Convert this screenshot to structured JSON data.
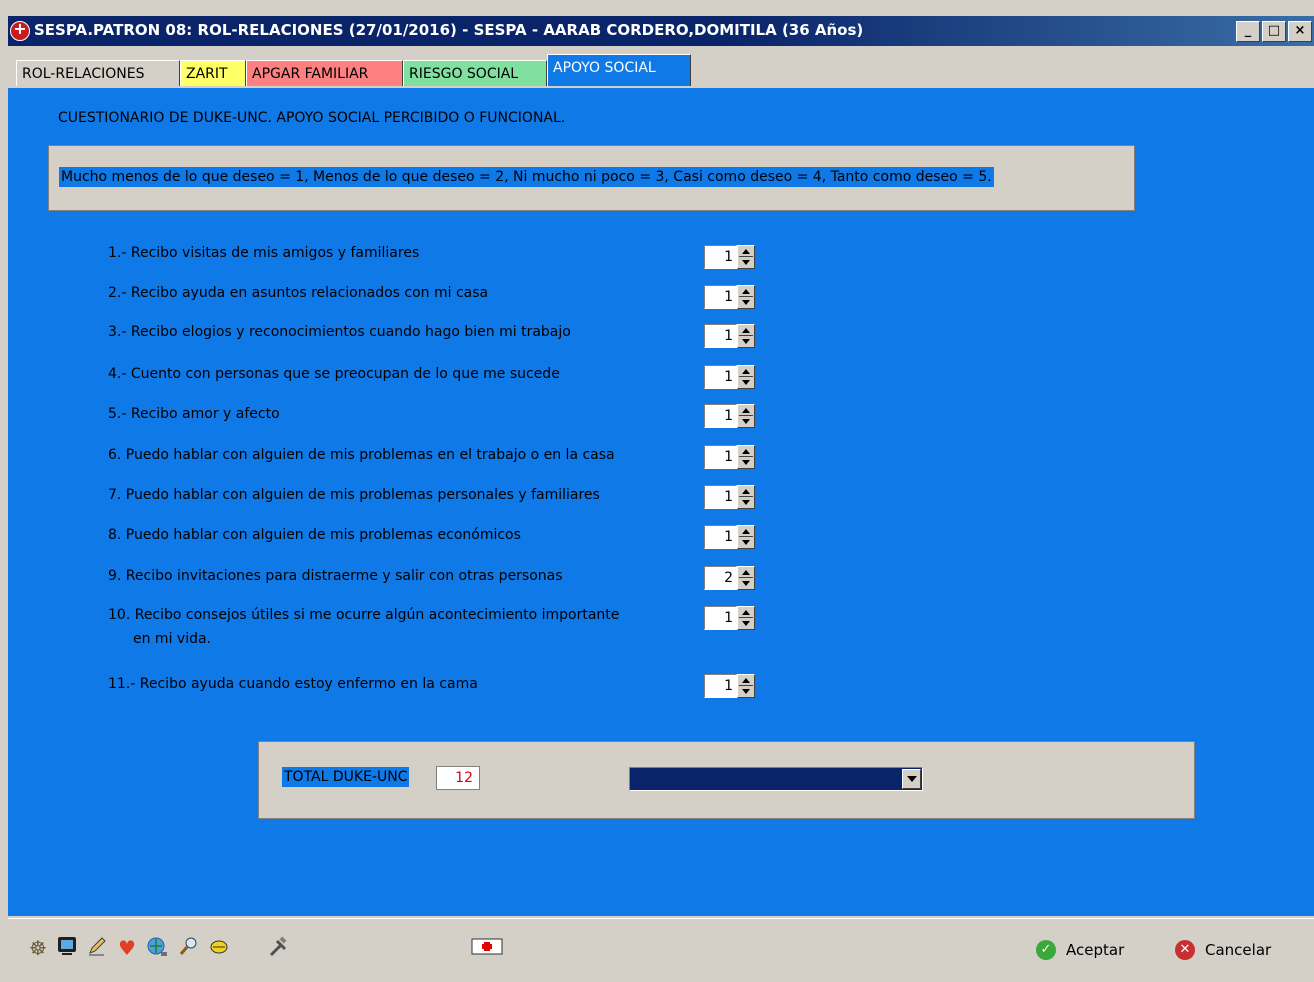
{
  "window": {
    "title": "SESPA.PATRON 08: ROL-RELACIONES (27/01/2016) - SESPA - AARAB CORDERO,DOMITILA (36 Años)",
    "minimize_label": "_",
    "maximize_label": "□",
    "close_label": "×"
  },
  "tabs": [
    {
      "label": "ROL-RELACIONES",
      "color": "#d4d0c8"
    },
    {
      "label": "ZARIT",
      "color": "#ffff66"
    },
    {
      "label": "APGAR FAMILIAR",
      "color": "#ff8080"
    },
    {
      "label": "RIESGO SOCIAL",
      "color": "#80e0a0"
    },
    {
      "label": "APOYO SOCIAL",
      "color": "#0f79e8"
    }
  ],
  "form": {
    "heading": "CUESTIONARIO DE DUKE-UNC. APOYO SOCIAL PERCIBIDO O FUNCIONAL.",
    "scale_text": "Mucho menos de lo que deseo = 1, Menos de lo que deseo = 2, Ni mucho ni poco = 3, Casi como deseo = 4, Tanto como deseo = 5.",
    "questions": [
      {
        "label": "1.- Recibo visitas de mis amigos y familiares",
        "value": "1"
      },
      {
        "label": "2.- Recibo ayuda en asuntos relacionados con mi casa",
        "value": "1"
      },
      {
        "label": "3.- Recibo elogios y reconocimientos cuando hago bien mi trabajo",
        "value": "1"
      },
      {
        "label": "4.- Cuento con personas que se preocupan de lo que me sucede",
        "value": "1"
      },
      {
        "label": "5.- Recibo amor y afecto",
        "value": "1"
      },
      {
        "label": "6. Puedo hablar con alguien de mis problemas en el trabajo o en la casa",
        "value": "1"
      },
      {
        "label": "7. Puedo hablar con alguien de mis problemas personales y familiares",
        "value": "1"
      },
      {
        "label": "8. Puedo hablar con alguien de mis problemas económicos",
        "value": "1"
      },
      {
        "label": "9. Recibo invitaciones para distraerme y salir con otras personas",
        "value": "2"
      },
      {
        "label": "10. Recibo consejos útiles si me ocurre algún acontecimiento importante",
        "label2": "en mi vida.",
        "value": "1"
      },
      {
        "label": "11.- Recibo ayuda cuando estoy enfermo en la cama",
        "value": "1"
      }
    ],
    "total_label": "TOTAL DUKE-UNC",
    "total_value": "12",
    "result_combo_value": ""
  },
  "toolbar": {
    "accept_label": "Aceptar",
    "cancel_label": "Cancelar",
    "tools": [
      "people-icon",
      "monitor-icon",
      "pencil-icon",
      "heart-icon",
      "globe-search-icon",
      "magnifier-icon",
      "pill-icon",
      "tools-icon",
      "first-aid-icon"
    ]
  },
  "colors": {
    "panel_blue": "#0f79e8",
    "title_navy": "#0a246a",
    "total_red": "#e00000"
  }
}
